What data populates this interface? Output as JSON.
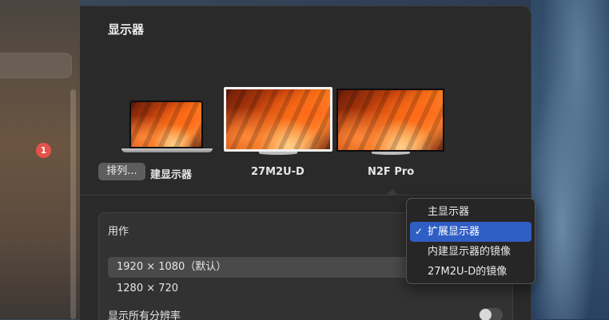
{
  "window": {
    "title": "显示器"
  },
  "sidebar": {
    "badge_count": "1"
  },
  "displays": [
    {
      "id": "built-in",
      "label": "建显示器",
      "selected": false
    },
    {
      "id": "27m2u",
      "label": "27M2U-D",
      "selected": true
    },
    {
      "id": "n2f",
      "label": "N2F Pro",
      "selected": false
    }
  ],
  "arrange_button": {
    "label": "排列..."
  },
  "settings": {
    "use_label": "用作",
    "resolutions": [
      {
        "label": "1920 × 1080（默认）",
        "selected": true
      },
      {
        "label": "1280 × 720",
        "selected": false
      }
    ],
    "show_all_label": "显示所有分辨率",
    "show_all_enabled": false
  },
  "use_menu": {
    "items": [
      {
        "label": "主显示器",
        "checked": false
      },
      {
        "label": "扩展显示器",
        "checked": true
      },
      {
        "label": "内建显示器的镜像",
        "checked": false
      },
      {
        "label": "27M2U-D的镜像",
        "checked": false
      }
    ],
    "check_mark": "✓"
  },
  "colors": {
    "accent": "#2f5ec4",
    "badge": "#e5534b",
    "panel": "#2b2a2a"
  }
}
